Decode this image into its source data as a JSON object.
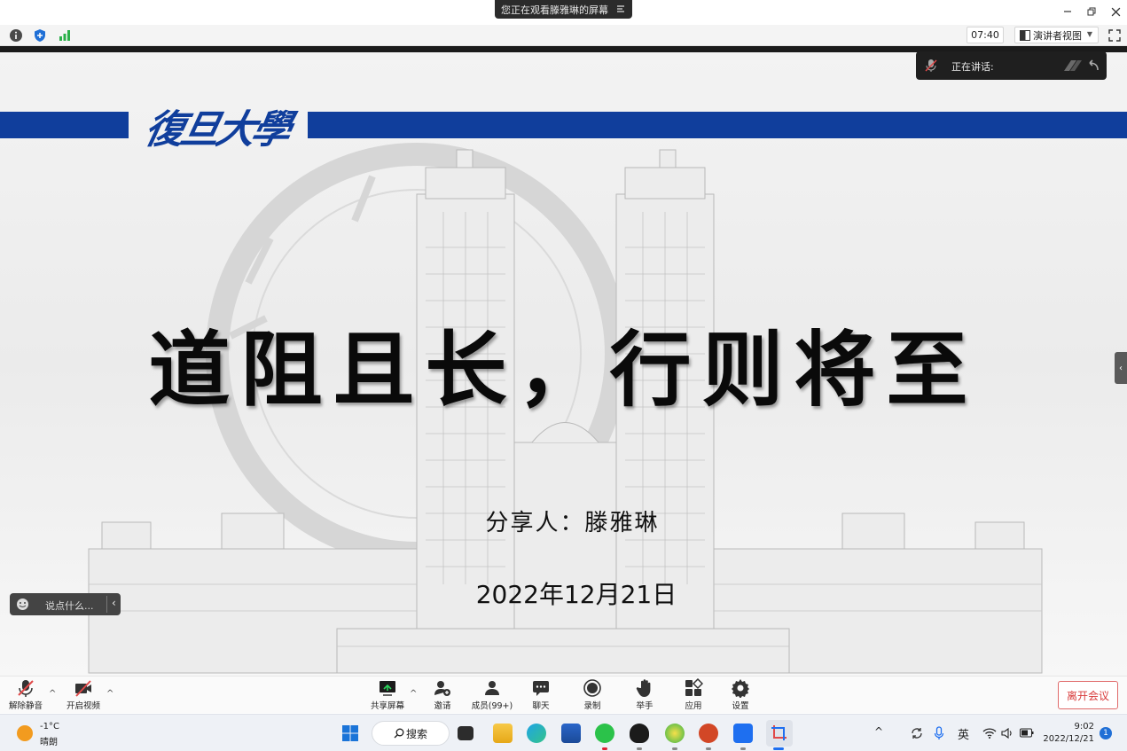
{
  "banner": {
    "sharing_text": "您正在观看滕雅琳的屏幕"
  },
  "infobar": {
    "timer": "07:40",
    "view_label": "演讲者视图"
  },
  "speaking": {
    "label": "正在讲话:"
  },
  "slide": {
    "logo_text": "復旦大學",
    "title": "道阻且长，行则将至",
    "presenter": "分享人：滕雅琳",
    "date": "2022年12月21日"
  },
  "chat": {
    "placeholder": "说点什么..."
  },
  "toolbar": {
    "unmute": "解除静音",
    "start_video": "开启视频",
    "share_screen": "共享屏幕",
    "invite": "邀请",
    "members": "成员(99+)",
    "chat": "聊天",
    "record": "录制",
    "raise_hand": "举手",
    "apps": "应用",
    "settings": "设置",
    "leave": "离开会议"
  },
  "taskbar": {
    "temperature": "-1°C",
    "weather": "晴朗",
    "search": "搜索",
    "ime": "英",
    "time": "9:02",
    "date": "2022/12/21",
    "notification_count": "1"
  },
  "colors": {
    "brand_blue": "#103e9c",
    "leave_red": "#d83a3a",
    "accent": "#1f6fd6"
  }
}
